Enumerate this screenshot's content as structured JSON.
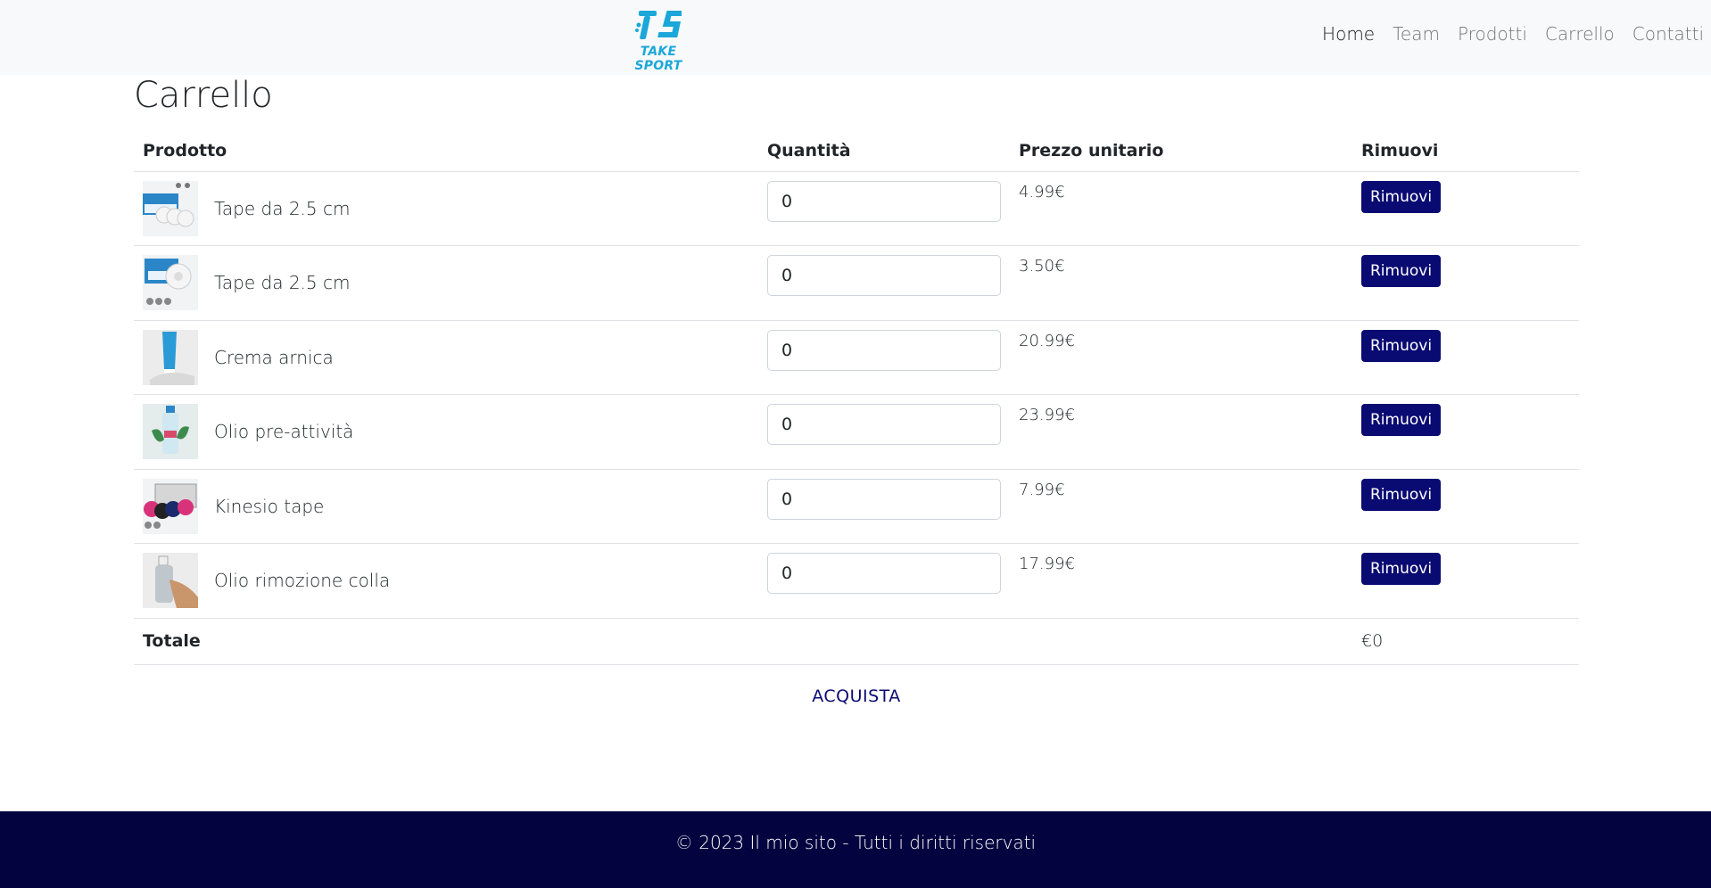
{
  "brand": {
    "logo_text": "TAKE SPORT",
    "color": "#1ba7d9"
  },
  "nav": {
    "items": [
      {
        "label": "Home",
        "active": true
      },
      {
        "label": "Team",
        "active": false
      },
      {
        "label": "Prodotti",
        "active": false
      },
      {
        "label": "Carrello",
        "active": false
      },
      {
        "label": "Contatti",
        "active": false
      }
    ]
  },
  "page": {
    "title": "Carrello"
  },
  "table": {
    "headers": {
      "product": "Prodotto",
      "quantity": "Quantità",
      "unit_price": "Prezzo unitario",
      "remove": "Rimuovi"
    },
    "rows": [
      {
        "name": "Tape da 2.5 cm",
        "quantity": "0",
        "price": "4.99€",
        "remove_label": "Rimuovi",
        "thumb_icon": "white-tape-box-icon"
      },
      {
        "name": "Tape da 2.5 cm",
        "quantity": "0",
        "price": "3.50€",
        "remove_label": "Rimuovi",
        "thumb_icon": "white-tape-roll-icon"
      },
      {
        "name": "Crema arnica",
        "quantity": "0",
        "price": "20.99€",
        "remove_label": "Rimuovi",
        "thumb_icon": "cream-tube-icon"
      },
      {
        "name": "Olio pre-attività",
        "quantity": "0",
        "price": "23.99€",
        "remove_label": "Rimuovi",
        "thumb_icon": "oil-bottle-icon"
      },
      {
        "name": "Kinesio tape",
        "quantity": "0",
        "price": "7.99€",
        "remove_label": "Rimuovi",
        "thumb_icon": "kinesio-tape-icon"
      },
      {
        "name": "Olio rimozione colla",
        "quantity": "0",
        "price": "17.99€",
        "remove_label": "Rimuovi",
        "thumb_icon": "spray-bottle-icon"
      }
    ],
    "total": {
      "label": "Totale",
      "value": "€0"
    }
  },
  "buy_label": "ACQUISTA",
  "footer": {
    "text": "© 2023 Il mio sito - Tutti i diritti riservati"
  },
  "colors": {
    "button": "#0a0a73",
    "footer": "#03033f",
    "navbar": "#f8f9fa"
  }
}
